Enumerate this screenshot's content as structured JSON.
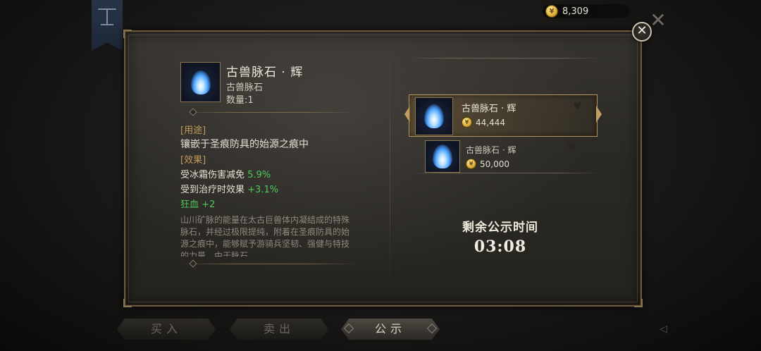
{
  "currency": {
    "amount": "8,309",
    "icon": "gold-coin-icon"
  },
  "item": {
    "name": "古兽脉石 · 辉",
    "type": "古兽脉石",
    "quantity": "数量:1",
    "usage_tag": "[用途]",
    "usage": "镶嵌于圣痕防具的始源之痕中",
    "effect_tag": "[效果]",
    "effects": [
      {
        "label": "受冰霜伤害减免",
        "value": "5.9%"
      },
      {
        "label": "受到治疗时效果",
        "value": "+3.1%"
      },
      {
        "label": "狂血",
        "value": "+2"
      }
    ],
    "lore": "山川矿脉的能量在太古巨兽体内凝结成的特殊脉石，并经过极限提纯，附着在圣痕防具的始源之痕中，能够赋予游骑兵坚韧、强健与特技的力量，由于脉石"
  },
  "listings": [
    {
      "name": "古兽脉石 · 辉",
      "price": "44,444"
    },
    {
      "name": "古兽脉石 · 辉",
      "price": "50,000"
    }
  ],
  "timer": {
    "label": "剩余公示时间",
    "value": "03:08"
  },
  "tabs": {
    "buy": "买入",
    "sell": "卖出",
    "public": "公示"
  },
  "colors": {
    "accent": "#b8965a",
    "bonus": "#4fc85a",
    "tag": "#c39a5a"
  }
}
